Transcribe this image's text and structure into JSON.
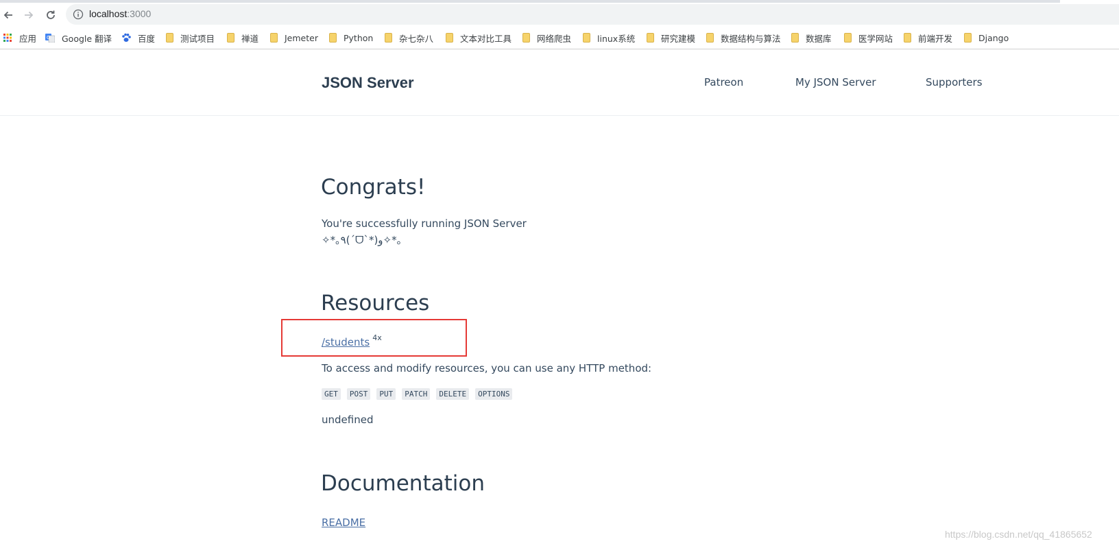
{
  "browser": {
    "url_host": "localhost",
    "url_port": ":3000",
    "bookmarks": [
      {
        "label": "应用",
        "icon": "apps-grid-icon"
      },
      {
        "label": "Google 翻译",
        "icon": "google-translate-icon"
      },
      {
        "label": "百度",
        "icon": "baidu-paw-icon"
      },
      {
        "label": "测试项目",
        "icon": "folder-icon"
      },
      {
        "label": "禅道",
        "icon": "folder-icon"
      },
      {
        "label": "Jemeter",
        "icon": "folder-icon"
      },
      {
        "label": "Python",
        "icon": "folder-icon"
      },
      {
        "label": "杂七杂八",
        "icon": "folder-icon"
      },
      {
        "label": "文本对比工具",
        "icon": "folder-icon"
      },
      {
        "label": "网络爬虫",
        "icon": "folder-icon"
      },
      {
        "label": "linux系统",
        "icon": "folder-icon"
      },
      {
        "label": "研究建模",
        "icon": "folder-icon"
      },
      {
        "label": "数据结构与算法",
        "icon": "folder-icon"
      },
      {
        "label": "数据库",
        "icon": "folder-icon"
      },
      {
        "label": "医学网站",
        "icon": "folder-icon"
      },
      {
        "label": "前端开发",
        "icon": "folder-icon"
      },
      {
        "label": "Django",
        "icon": "folder-icon"
      }
    ]
  },
  "header": {
    "brand": "JSON Server",
    "nav": [
      "Patreon",
      "My JSON Server",
      "Supporters"
    ]
  },
  "main": {
    "congrats_title": "Congrats!",
    "congrats_text": "You're successfully running JSON Server",
    "congrats_emoticon": "✧*｡٩(ˊᗜˋ*)و✧*｡",
    "resources_title": "Resources",
    "resource_link": "/students",
    "resource_count": "4x",
    "access_text": "To access and modify resources, you can use any HTTP method:",
    "methods": [
      "GET",
      "POST",
      "PUT",
      "PATCH",
      "DELETE",
      "OPTIONS"
    ],
    "undefined_text": "undefined",
    "docs_title": "Documentation",
    "readme_link": "README"
  },
  "watermark": "https://blog.csdn.net/qq_41865652",
  "colors": {
    "highlight_box": "#e53935",
    "link": "#4a6fa5",
    "folder": "#f6d36b"
  }
}
